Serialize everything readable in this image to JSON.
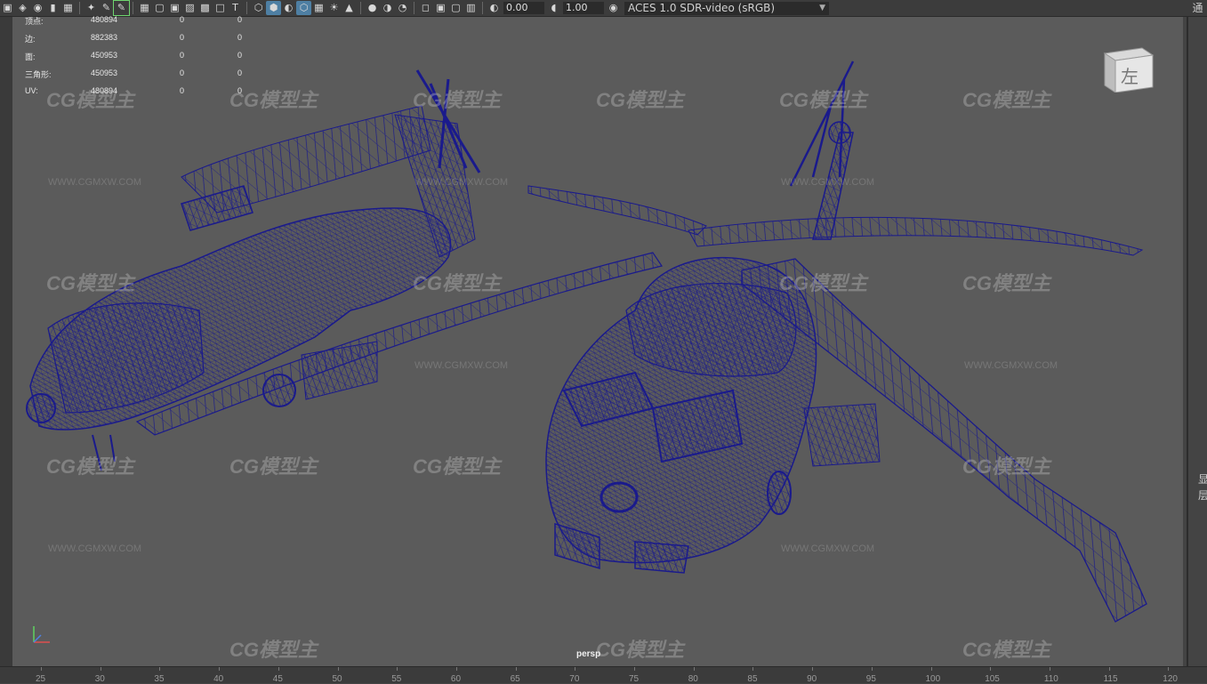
{
  "toolbar": {
    "value_a": "0.00",
    "value_b": "1.00",
    "color_management": "ACES 1.0 SDR-video (sRGB)",
    "icons": [
      "camera-icon",
      "camera-lock-icon",
      "bookmark-icon",
      "image-plane-icon",
      "grid-icon",
      "wireframe-icon",
      "shaded-icon",
      "textured-icon",
      "lights-icon",
      "shadows-icon",
      "xray-icon",
      "isolate-icon",
      "exposure-icon",
      "gamma-icon",
      "color-management-icon"
    ]
  },
  "hud": {
    "rows": [
      {
        "label": "顶点:",
        "v1": "480894",
        "v2": "0",
        "v3": "0"
      },
      {
        "label": "边:",
        "v1": "882383",
        "v2": "0",
        "v3": "0"
      },
      {
        "label": "面:",
        "v1": "450953",
        "v2": "0",
        "v3": "0"
      },
      {
        "label": "三角形:",
        "v1": "450953",
        "v2": "0",
        "v3": "0"
      },
      {
        "label": "UV:",
        "v1": "480894",
        "v2": "0",
        "v3": "0"
      }
    ]
  },
  "viewport": {
    "camera_label": "persp",
    "viewcube_label": "左",
    "watermark_logo": "CG模型主",
    "watermark_url": "WWW.CGMXW.COM",
    "wire_color": "#1a1a8c",
    "background_color": "#5b5b5b"
  },
  "right_panel": {
    "top_glyph": "通",
    "glyph_1": "显",
    "glyph_2": "层"
  },
  "ruler": {
    "labels": [
      "25",
      "30",
      "35",
      "40",
      "45",
      "50",
      "55",
      "60",
      "65",
      "70",
      "75",
      "80",
      "85",
      "90",
      "95",
      "100",
      "105",
      "110",
      "115",
      "120"
    ]
  }
}
